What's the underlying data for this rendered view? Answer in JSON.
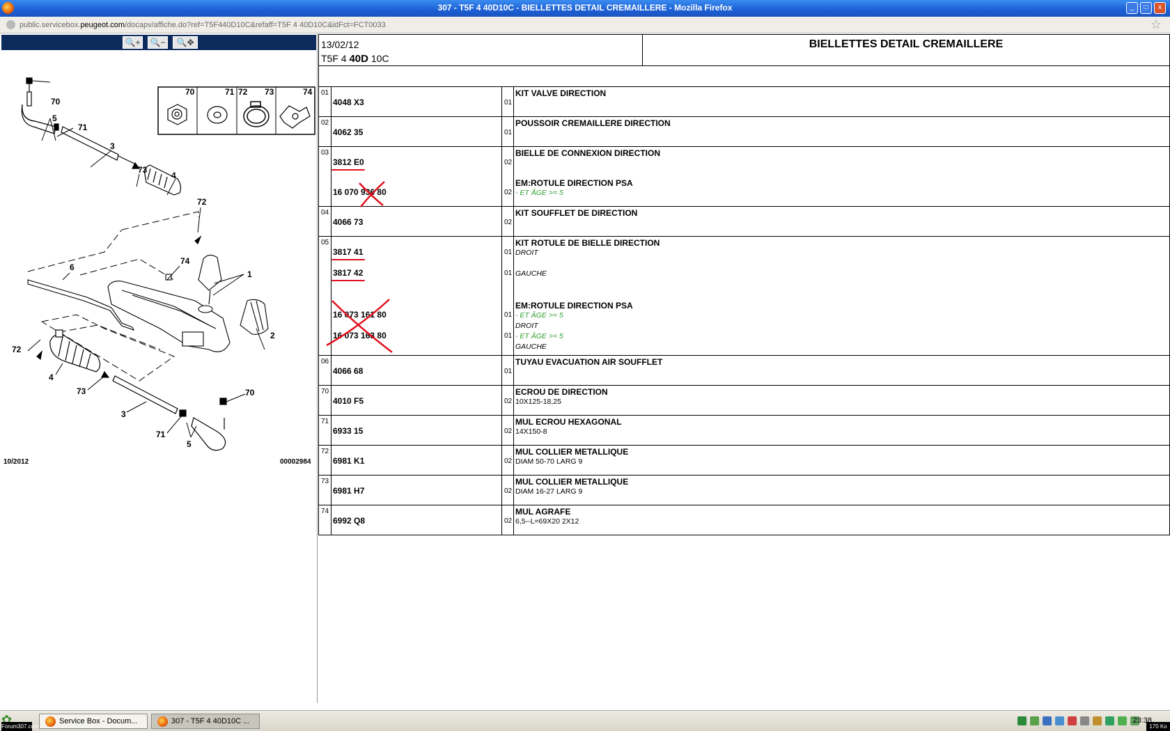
{
  "window": {
    "title": "307 - T5F 4 40D10C - BIELLETTES DETAIL CREMAILLERE - Mozilla Firefox",
    "minimize_label": "_",
    "maximize_label": "□",
    "close_label": "x"
  },
  "urlbar": {
    "url_prefix": "public.servicebox.",
    "url_domain": "peugeot.com",
    "url_path": "/docapv/affiche.do?ref=T5F440D10C&refaff=T5F 4 40D10C&idFct=FCT0033"
  },
  "diagram": {
    "zoom_in_label": "🔍+",
    "zoom_out_label": "🔍−",
    "zoom_move_label": "🔍✥",
    "legend_numbers": [
      "70",
      "71",
      "72",
      "73",
      "74"
    ],
    "callouts": [
      "70",
      "5",
      "71",
      "3",
      "73",
      "4",
      "72",
      "6",
      "74",
      "1",
      "2",
      "72",
      "4",
      "73",
      "3",
      "71",
      "5",
      "70"
    ],
    "footer_left": "10/2012",
    "footer_right": "00002984"
  },
  "header": {
    "date": "13/02/12",
    "code_prefix": "T5F 4 ",
    "code_bold": "40D",
    "code_suffix": " 10C",
    "title": "BIELLETTES DETAIL CREMAILLERE"
  },
  "parts": [
    {
      "num": "01",
      "refs": [
        {
          "ref": "4048 X3",
          "qty": "01"
        }
      ],
      "title": "KIT VALVE DIRECTION",
      "notes": []
    },
    {
      "num": "02",
      "refs": [
        {
          "ref": "4062 35",
          "qty": "01"
        }
      ],
      "title": "POUSSOIR CREMAILLERE DIRECTION",
      "notes": []
    },
    {
      "num": "03",
      "refs": [
        {
          "ref": "3812 E0",
          "qty": "02"
        },
        {
          "ref": "16 070 936 80",
          "qty": "02"
        }
      ],
      "title": "BIELLE DE CONNEXION DIRECTION",
      "title2": "EM:ROTULE DIRECTION PSA",
      "notes": [
        "- ET ÂGE >= 5"
      ]
    },
    {
      "num": "04",
      "refs": [
        {
          "ref": "4066 73",
          "qty": "02"
        }
      ],
      "title": "KIT SOUFFLET DE DIRECTION",
      "notes": []
    },
    {
      "num": "05",
      "refs": [
        {
          "ref": "3817 41",
          "qty": "01"
        },
        {
          "ref": "3817 42",
          "qty": "01"
        },
        {
          "ref": "16 073 161 80",
          "qty": "01"
        },
        {
          "ref": "16 073 163 80",
          "qty": "01"
        }
      ],
      "title": "KIT ROTULE DE BIELLE DIRECTION",
      "title2": "EM:ROTULE DIRECTION PSA",
      "notes": [
        "DROIT",
        "GAUCHE",
        "- ET ÂGE >= 5",
        "DROIT",
        "- ET ÂGE >= 5",
        "GAUCHE"
      ]
    },
    {
      "num": "06",
      "refs": [
        {
          "ref": "4066 68",
          "qty": "01"
        }
      ],
      "title": "TUYAU EVACUATION AIR SOUFFLET",
      "notes": []
    },
    {
      "num": "70",
      "refs": [
        {
          "ref": "4010 F5",
          "qty": "02"
        }
      ],
      "title": "ECROU DE DIRECTION",
      "notes": [
        "10X125-18,25"
      ]
    },
    {
      "num": "71",
      "refs": [
        {
          "ref": "6933 15",
          "qty": "02"
        }
      ],
      "title": "MUL ECROU HEXAGONAL",
      "notes": [
        "14X150-8"
      ]
    },
    {
      "num": "72",
      "refs": [
        {
          "ref": "6981 K1",
          "qty": "02"
        }
      ],
      "title": "MUL COLLIER METALLIQUE",
      "notes": [
        "DIAM 50-70 LARG 9"
      ]
    },
    {
      "num": "73",
      "refs": [
        {
          "ref": "6981 H7",
          "qty": "02"
        }
      ],
      "title": "MUL COLLIER METALLIQUE",
      "notes": [
        "DIAM 16-27 LARG 9"
      ]
    },
    {
      "num": "74",
      "refs": [
        {
          "ref": "6992 Q8",
          "qty": "02"
        }
      ],
      "title": "MUL AGRAFE",
      "notes": [
        "6,5--L=69X20 2X12"
      ]
    }
  ],
  "taskbar": {
    "tasks": [
      "Service Box - Docum...",
      "307 - T5F 4 40D10C ..."
    ],
    "clock": "23:38"
  },
  "watermark": "Forum307.com",
  "speed": "170 Ko",
  "colors": {
    "titlebar": "#2464d8",
    "zoombar": "#0d2a5d",
    "annotation_red": "#e0101c",
    "note_green": "#2e9d2e"
  }
}
